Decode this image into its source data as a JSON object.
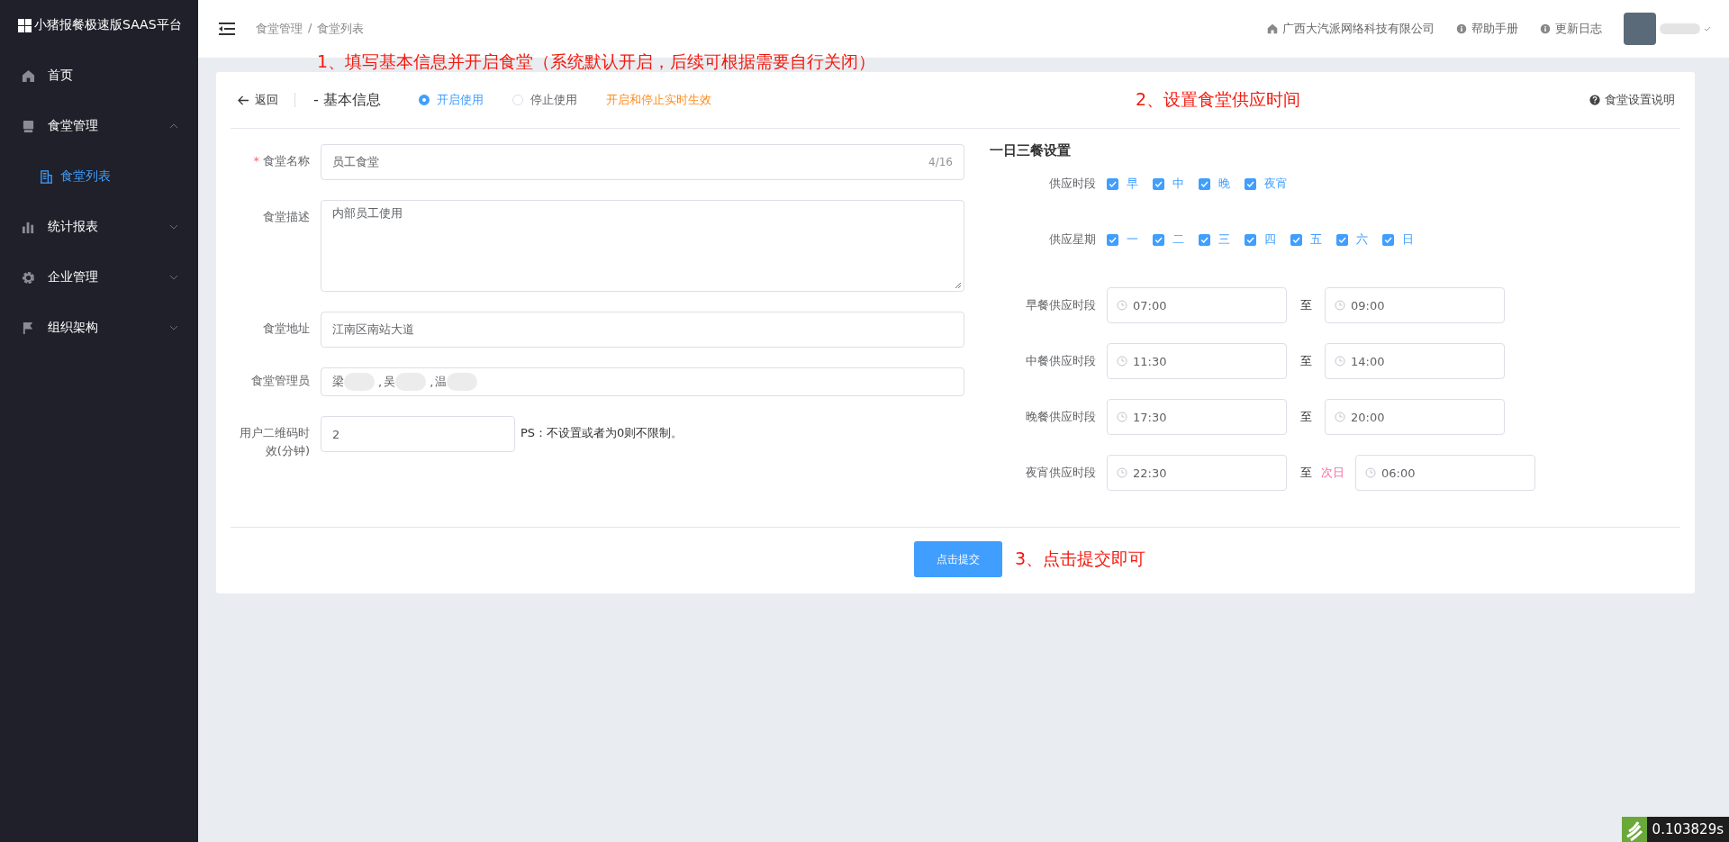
{
  "sidebar": {
    "logo": "小猪报餐极速版SAAS平台",
    "items": [
      {
        "label": "首页"
      },
      {
        "label": "食堂管理",
        "expanded": true,
        "children": [
          {
            "label": "食堂列表",
            "selected": true
          }
        ]
      },
      {
        "label": "统计报表",
        "expanded": false
      },
      {
        "label": "企业管理",
        "expanded": false
      },
      {
        "label": "组织架构",
        "expanded": false
      }
    ]
  },
  "header": {
    "breadcrumb": [
      "食堂管理",
      "食堂列表"
    ],
    "separator": "/",
    "links": [
      "广西大汽派网络科技有限公司",
      "帮助手册",
      "更新日志"
    ]
  },
  "annotations": [
    "1、填写基本信息并开启食堂（系统默认开启，后续可根据需要自行关闭）",
    "2、设置食堂供应时间",
    "3、点击提交即可"
  ],
  "card": {
    "back": "返回",
    "title": "- 基本信息",
    "status_options": [
      {
        "label": "开启使用",
        "selected": true
      },
      {
        "label": "停止使用",
        "selected": false
      }
    ],
    "status_hint": "开启和停止实时生效",
    "help": "食堂设置说明"
  },
  "form": [
    {
      "kind": "input",
      "label": "食堂名称",
      "required_mark": "*",
      "value": "员工食堂",
      "counter": "4/16"
    },
    {
      "kind": "textarea",
      "label": "食堂描述",
      "value": "内部员工使用"
    },
    {
      "kind": "input",
      "label": "食堂地址",
      "value": "江南区南站大道"
    },
    {
      "kind": "people",
      "label": "食堂管理员",
      "people": [
        "梁",
        "吴",
        "温"
      ],
      "separator": ","
    },
    {
      "kind": "short",
      "label": "用户二维码时效(分钟)",
      "value": "2",
      "note": "PS：不设置或者为0则不限制。"
    }
  ],
  "meals": {
    "title": "一日三餐设置",
    "periods_label": "供应时段",
    "periods": [
      {
        "label": "早",
        "checked": true
      },
      {
        "label": "中",
        "checked": true
      },
      {
        "label": "晚",
        "checked": true
      },
      {
        "label": "夜宵",
        "checked": true
      }
    ],
    "weekdays_label": "供应星期",
    "weekdays": [
      {
        "label": "一",
        "checked": true
      },
      {
        "label": "二",
        "checked": true
      },
      {
        "label": "三",
        "checked": true
      },
      {
        "label": "四",
        "checked": true
      },
      {
        "label": "五",
        "checked": true
      },
      {
        "label": "六",
        "checked": true
      },
      {
        "label": "日",
        "checked": true
      }
    ],
    "times": [
      {
        "label": "早餐供应时段",
        "start": "07:00",
        "to": "至",
        "end": "09:00"
      },
      {
        "label": "中餐供应时段",
        "start": "11:30",
        "to": "至",
        "end": "14:00"
      },
      {
        "label": "晚餐供应时段",
        "start": "17:30",
        "to": "至",
        "end": "20:00"
      },
      {
        "label": "夜宵供应时段",
        "start": "22:30",
        "to": "至",
        "next_day": "次日",
        "end": "06:00"
      }
    ]
  },
  "submit": "点击提交",
  "timer": "0.103829s"
}
